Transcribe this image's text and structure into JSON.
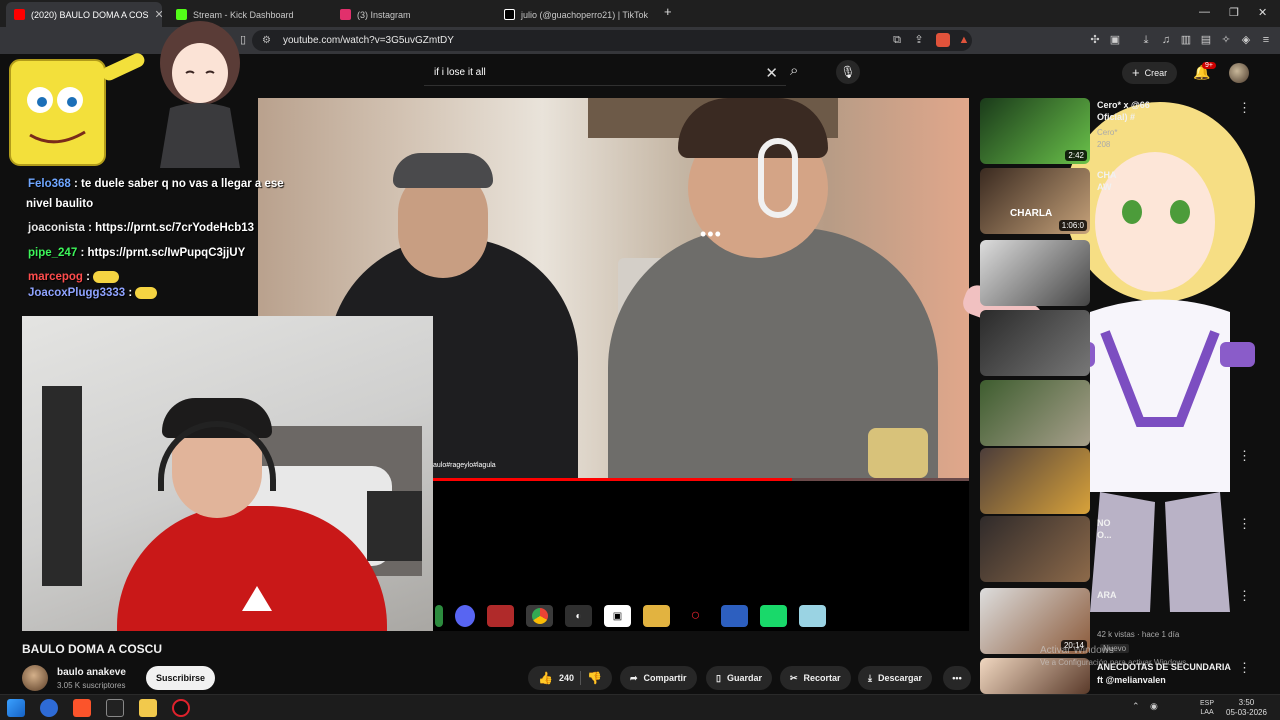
{
  "browser": {
    "tabs": [
      {
        "label": "(2020) BAULO DOMA A COS",
        "active": true,
        "color": "#ff0000"
      },
      {
        "label": "Stream - Kick Dashboard",
        "active": false,
        "color": "#53fc18"
      },
      {
        "label": "(3) Instagram",
        "active": false,
        "color": "#e1306c"
      },
      {
        "label": "julio (@guachoperro21) | TikTok",
        "active": false,
        "color": "#ffffff"
      }
    ],
    "new_tab": "+",
    "url": "youtube.com/watch?v=3G5uvGZmtDY"
  },
  "youtube": {
    "search_value": "if i lose it all",
    "create_label": "Crear",
    "notif_count": "9+"
  },
  "overlay": {
    "chat": [
      {
        "user": "Felo368",
        "text": ": te duele saber q no vas a llegar a ese"
      },
      {
        "user": "",
        "text": "nivel baulito"
      },
      {
        "user": "joaconista",
        "text": ": https://prnt.sc/7crYodeHcb13"
      },
      {
        "user": "pipe_247",
        "text": ": https://prnt.sc/IwPupqC3jjUY"
      },
      {
        "user": "marcepog",
        "text": ":"
      },
      {
        "user": "JoacoxPlugg3333",
        "text": ":"
      }
    ],
    "watermark": "aulo#rageylo#lagula"
  },
  "video": {
    "title": "BAULO DOMA A COSCU",
    "channel": "baulo anakeve",
    "subscribers": "3.05 K suscriptores",
    "subscribe_label": "Suscribirse",
    "likes": "240",
    "share_label": "Compartir",
    "save_label": "Guardar",
    "clip_label": "Recortar",
    "download_label": "Descargar",
    "progress_fraction": 0.67
  },
  "recommendations": [
    {
      "title": "Cero* x @66",
      "meta": "Oficial) #",
      "sub": "Cero*",
      "views": "208",
      "duration": "2:42"
    },
    {
      "title": "CHA",
      "meta": "AW",
      "sub": "",
      "views": "",
      "duration": "1:06:0"
    },
    {
      "title": "",
      "meta": "",
      "sub": "",
      "views": "",
      "duration": ""
    },
    {
      "title": "",
      "meta": "",
      "sub": "",
      "views": "",
      "duration": ""
    },
    {
      "title": "NO",
      "meta": "O...",
      "sub": "",
      "views": "",
      "duration": ""
    },
    {
      "title": "ARA",
      "meta": "",
      "sub": "",
      "views": "",
      "duration": ""
    },
    {
      "title": "",
      "meta": "42 k vistas · hace 1 día",
      "sub": "Nuevo",
      "views": "",
      "duration": "20:14"
    },
    {
      "title": "ANECDOTAS DE SECUNDARIA",
      "meta": "ft @melianvalen",
      "sub": "",
      "views": "",
      "duration": ""
    }
  ],
  "windows": {
    "activate_line1": "Activar Windows",
    "activate_line2": "Ve a Configuración para activar Windows.",
    "clock_time": "3:50",
    "clock_date": "05-03-2026",
    "lang": "ESP",
    "lang2": "LAA"
  },
  "icons": {
    "search": "search-icon",
    "mic": "mic-icon",
    "bell": "bell-icon",
    "like": "thumbs-up-icon",
    "dislike": "thumbs-down-icon",
    "share": "share-icon",
    "save": "bookmark-icon",
    "clip": "scissors-icon",
    "download": "download-icon",
    "more": "more-icon"
  }
}
